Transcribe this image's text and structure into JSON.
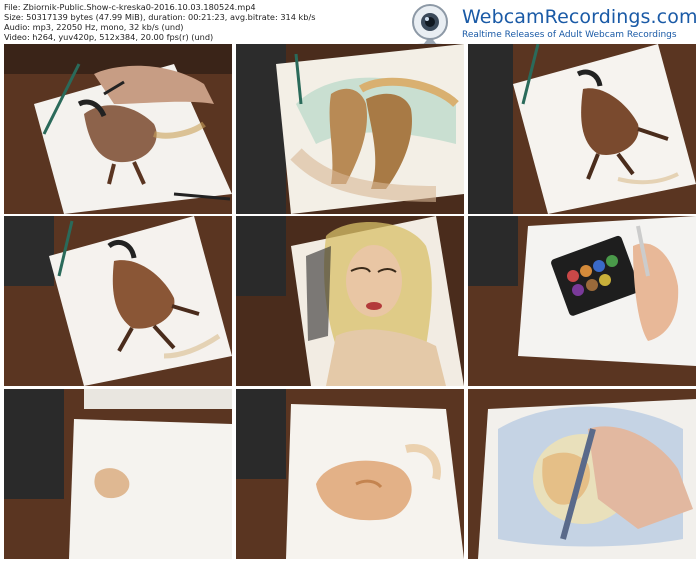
{
  "info": {
    "file": "File: Zbiornik-Public.Show-c-kreska0-2016.10.03.180524.mp4",
    "size": "Size: 50317139 bytes (47.99 MiB), duration: 00:21:23, avg.bitrate: 314 kb/s",
    "audio": "Audio: mp3, 22050 Hz, mono, 32 kb/s (und)",
    "video": "Video: h264, yuv420p, 512x384, 20.00 fps(r) (und)"
  },
  "logo": {
    "brand": "WebcamRecordings.com",
    "tagline": "Realtime Releases of Adult Webcam Recordings"
  },
  "thumbnails": [
    {
      "subject": "horse-sketch-drawing"
    },
    {
      "subject": "two-horses-painting"
    },
    {
      "subject": "galloping-horse-painting"
    },
    {
      "subject": "galloping-horse-painting-2"
    },
    {
      "subject": "woman-portrait-painting"
    },
    {
      "subject": "watercolor-palette"
    },
    {
      "subject": "blank-paper-start"
    },
    {
      "subject": "face-wash-progress"
    },
    {
      "subject": "painting-background"
    }
  ],
  "colors": {
    "brand": "#1a5aa6",
    "table": "#6b4028",
    "paper": "#f4f2ee"
  }
}
